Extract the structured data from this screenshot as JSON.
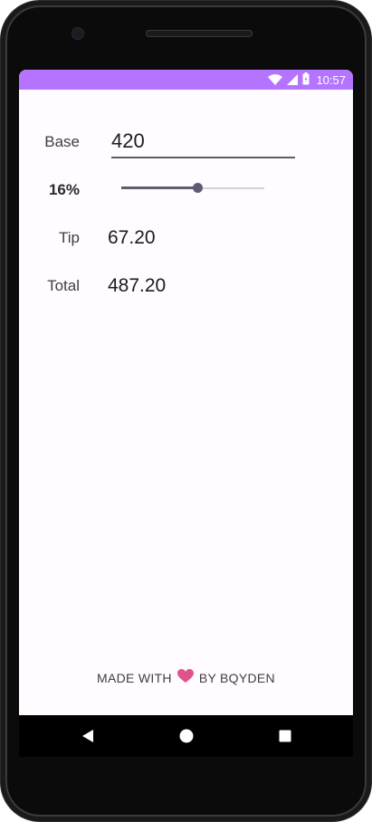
{
  "status_bar": {
    "time": "10:57",
    "icons": [
      "wifi-icon",
      "cell-signal-icon",
      "battery-icon"
    ],
    "color": "#b574ff"
  },
  "form": {
    "base_label": "Base",
    "base_value": "420",
    "percent_label": "16%",
    "tip_percent": 16,
    "slider_min": 0,
    "slider_max": 30,
    "tip_label": "Tip",
    "tip_value": "67.20",
    "total_label": "Total",
    "total_value": "487.20"
  },
  "footer": {
    "made_with": "MADE WITH",
    "heart_icon": "heart-icon",
    "heart_color": "#e0528e",
    "by": "BY BQYDEN"
  },
  "nav_bar": {
    "buttons": [
      "back-icon",
      "home-icon",
      "recents-icon"
    ]
  }
}
